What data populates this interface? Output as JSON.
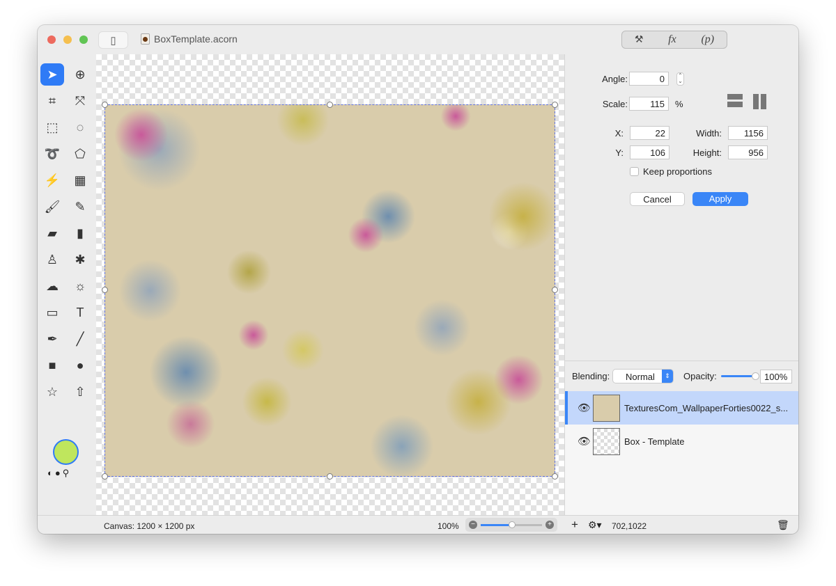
{
  "window": {
    "title": "BoxTemplate.acorn"
  },
  "toolbar": {
    "segments": [
      "hammer-brush-icon",
      "fx",
      "(p)"
    ],
    "fx_label": "fx",
    "p_label": "(p)"
  },
  "tools": [
    {
      "name": "select-arrow",
      "glyph": "➤"
    },
    {
      "name": "zoom",
      "glyph": "⊕"
    },
    {
      "name": "crop",
      "glyph": "⌗"
    },
    {
      "name": "resize",
      "glyph": "⤧"
    },
    {
      "name": "rect-select",
      "glyph": "⬚"
    },
    {
      "name": "ellipse-select",
      "glyph": "◌"
    },
    {
      "name": "lasso",
      "glyph": "➰"
    },
    {
      "name": "polygon-lasso",
      "glyph": "⬠"
    },
    {
      "name": "magic-wand",
      "glyph": "⚡"
    },
    {
      "name": "instant-alpha",
      "glyph": "▦"
    },
    {
      "name": "brush",
      "glyph": "🖌"
    },
    {
      "name": "pencil",
      "glyph": "✎"
    },
    {
      "name": "paint-bucket",
      "glyph": "▰"
    },
    {
      "name": "eraser",
      "glyph": "▮"
    },
    {
      "name": "clone-stamp",
      "glyph": "♙"
    },
    {
      "name": "smudge",
      "glyph": "✱"
    },
    {
      "name": "burn",
      "glyph": "☁"
    },
    {
      "name": "dodge",
      "glyph": "☼"
    },
    {
      "name": "gradient",
      "glyph": "▭"
    },
    {
      "name": "text",
      "glyph": "T"
    },
    {
      "name": "bezier-pen",
      "glyph": "✒"
    },
    {
      "name": "line",
      "glyph": "╱"
    },
    {
      "name": "rectangle",
      "glyph": "■"
    },
    {
      "name": "oval",
      "glyph": "●"
    },
    {
      "name": "star",
      "glyph": "☆"
    },
    {
      "name": "arrow",
      "glyph": "⇧"
    }
  ],
  "colors": {
    "foreground": "#bfe65d",
    "accent": "#2f7bf6",
    "selection": "#c3d7fb"
  },
  "transform": {
    "angle_label": "Angle:",
    "angle": "0",
    "scale_label": "Scale:",
    "scale": "115",
    "scale_unit": "%",
    "x_label": "X:",
    "x": "22",
    "y_label": "Y:",
    "y": "106",
    "width_label": "Width:",
    "width": "1156",
    "height_label": "Height:",
    "height": "956",
    "keep_proportions_label": "Keep proportions",
    "keep_proportions": false,
    "cancel": "Cancel",
    "apply": "Apply"
  },
  "layers_panel": {
    "blending_label": "Blending:",
    "blending": "Normal",
    "opacity_label": "Opacity:",
    "opacity": "100%",
    "opacity_value": 100,
    "layers": [
      {
        "name": "TexturesCom_WallpaperForties0022_s...",
        "visible": true,
        "selected": true
      },
      {
        "name": "Box - Template",
        "visible": true,
        "selected": false
      }
    ]
  },
  "status": {
    "canvas": "Canvas: 1200 × 1200 px",
    "zoom": "100%",
    "zoom_slider": 0.5,
    "coords": "702,1022"
  }
}
